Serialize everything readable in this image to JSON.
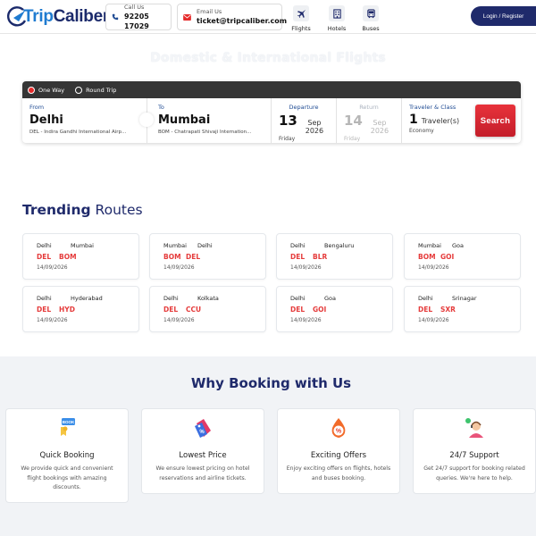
{
  "brand": {
    "name_part1": "Trip",
    "name_part2": "Caliber"
  },
  "contact": {
    "call_label": "Call Us",
    "call_value": "92205 17029",
    "email_label": "Email Us",
    "email_value": "ticket@tripcaliber.com"
  },
  "nav": {
    "flights": "Flights",
    "hotels": "Hotels",
    "buses": "Buses"
  },
  "login_label": "Login / Register",
  "hero": {
    "title": "Domestic & International Flights"
  },
  "search": {
    "trip_types": {
      "one_way": "One Way",
      "round_trip": "Round Trip",
      "selected": "One Way"
    },
    "from": {
      "label": "From",
      "city": "Delhi",
      "airport": "DEL - Indira Gandhi International Airp..."
    },
    "to": {
      "label": "To",
      "city": "Mumbai",
      "airport": "BOM - Chatrapati Shivaji Internation..."
    },
    "departure": {
      "label": "Departure",
      "day": "13",
      "month_year": "Sep 2026",
      "weekday": "Friday"
    },
    "return": {
      "label": "Return",
      "day": "14",
      "month_year": "Sep 2026",
      "weekday": "Friday"
    },
    "traveler": {
      "label": "Traveler & Class",
      "count": "1",
      "unit": "Traveler(s)",
      "class": "Economy"
    },
    "button_label": "Search"
  },
  "trending": {
    "title_bold": "Trending",
    "title_rest": " Routes",
    "routes": [
      {
        "from_city": "Delhi",
        "to_city": "Mumbai",
        "from_code": "DEL",
        "to_code": "BOM",
        "date": "14/09/2026"
      },
      {
        "from_city": "Mumbai",
        "to_city": "Delhi",
        "from_code": "BOM",
        "to_code": "DEL",
        "date": "14/09/2026"
      },
      {
        "from_city": "Delhi",
        "to_city": "Bengaluru",
        "from_code": "DEL",
        "to_code": "BLR",
        "date": "14/09/2026"
      },
      {
        "from_city": "Mumbai",
        "to_city": "Goa",
        "from_code": "BOM",
        "to_code": "GOI",
        "date": "14/09/2026"
      },
      {
        "from_city": "Delhi",
        "to_city": "Hyderabad",
        "from_code": "DEL",
        "to_code": "HYD",
        "date": "14/09/2026"
      },
      {
        "from_city": "Delhi",
        "to_city": "Kolkata",
        "from_code": "DEL",
        "to_code": "CCU",
        "date": "14/09/2026"
      },
      {
        "from_city": "Delhi",
        "to_city": "Goa",
        "from_code": "DEL",
        "to_code": "GOI",
        "date": "14/09/2026"
      },
      {
        "from_city": "Delhi",
        "to_city": "Srinagar",
        "from_code": "DEL",
        "to_code": "SXR",
        "date": "14/09/2026"
      }
    ]
  },
  "why": {
    "title": "Why Booking with Us",
    "features": [
      {
        "icon": "book-ticket-icon",
        "title": "Quick Booking",
        "text": "We provide quick and convenient flight bookings with amazing discounts."
      },
      {
        "icon": "price-tag-icon",
        "title": "Lowest Price",
        "text": "We ensure lowest pricing on hotel reservations and airline tickets."
      },
      {
        "icon": "discount-fire-icon",
        "title": "Exciting Offers",
        "text": "Enjoy exciting offers on flights, hotels and buses booking."
      },
      {
        "icon": "support-agent-icon",
        "title": "24/7 Support",
        "text": "Get 24/7 support for booking related queries. We're here to help."
      }
    ]
  },
  "colors": {
    "navy": "#1f2a6b",
    "accent_red": "#e52b2b",
    "brand_blue": "#1f7bd0"
  }
}
